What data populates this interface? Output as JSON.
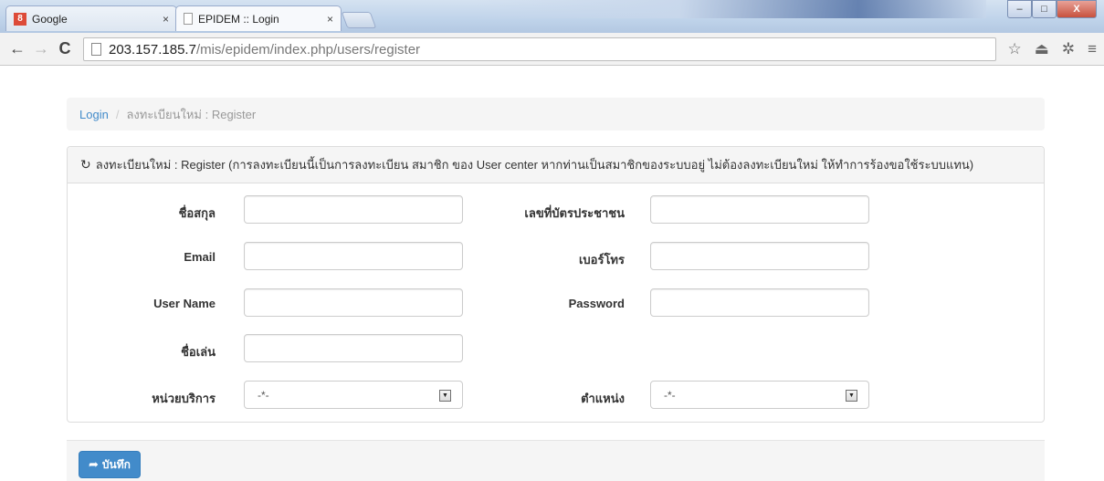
{
  "browser": {
    "tabs": [
      {
        "title": "Google",
        "favicon": "google-plus-icon",
        "active": false
      },
      {
        "title": "EPIDEM :: Login",
        "favicon": "page-icon",
        "active": true
      }
    ],
    "tab_close_glyph": "×",
    "url_host": "203.157.185.7",
    "url_path": "/mis/epidem/index.php/users/register",
    "window_buttons": {
      "minimize": "–",
      "maximize": "□",
      "close": "X"
    }
  },
  "breadcrumb": {
    "link": "Login",
    "separator": "/",
    "current": "ลงทะเบียนใหม่ : Register"
  },
  "panel": {
    "heading_icon": "refresh-icon",
    "heading": "ลงทะเบียนใหม่ : Register (การลงทะเบียนนี้เป็นการลงทะเบียน สมาชิก ของ User center หากท่านเป็นสมาชิกของระบบอยู่ ไม่ต้องลงทะเบียนใหม่ ให้ทำการร้องขอใช้ระบบแทน)"
  },
  "form": {
    "fullname_label": "ชื่อสกุล",
    "id_card_label": "เลขที่บัตรประชาชน",
    "email_label": "Email",
    "phone_label": "เบอร์โทร",
    "username_label": "User Name",
    "password_label": "Password",
    "nickname_label": "ชื่อเล่น",
    "unit_label": "หน่วยบริการ",
    "unit_selected": "-*-",
    "position_label": "ตำแหน่ง",
    "position_selected": "-*-"
  },
  "footer": {
    "save_label": "บันทึก",
    "save_icon": "save-icon"
  },
  "colors": {
    "primary": "#428bca",
    "link": "#428bca",
    "panel_bg": "#f5f5f5"
  }
}
